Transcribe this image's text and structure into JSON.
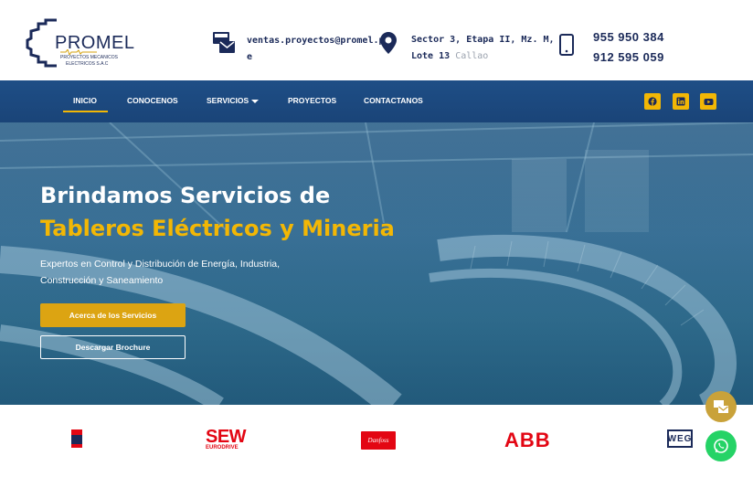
{
  "header": {
    "logo": {
      "name": "PROMEL",
      "subtitle_line1": "PROYECTOS MECANICOS",
      "subtitle_line2": "ELECTRICOS S.A.C"
    },
    "email": {
      "line1": "ventas.proyectos@promel.p",
      "line2": "e",
      "icon": "email-icon"
    },
    "address": {
      "line1": "Sector 3, Etapa II, Mz. M,",
      "line2_bold": "Lote 13",
      "line2_muted": "Callao",
      "icon": "map-pin-icon"
    },
    "phone": {
      "line1": "955 950 384",
      "line2": "912 595 059",
      "icon": "mobile-phone-icon"
    }
  },
  "nav": {
    "items": [
      {
        "label": "INICIO",
        "active": true
      },
      {
        "label": "CONOCENOS"
      },
      {
        "label": "SERVICIOS",
        "has_dropdown": true
      },
      {
        "label": "PROYECTOS"
      },
      {
        "label": "CONTACTANOS"
      }
    ],
    "social": [
      "facebook-icon",
      "linkedin-icon",
      "youtube-icon"
    ]
  },
  "hero": {
    "title_line1": "Brindamos Servicios de",
    "title_line2": "Tableros Eléctricos y Mineria",
    "subtitle_line1": "Expertos en Control y Distribución de Energía, Industria,",
    "subtitle_line2": "Construcción y Saneamiento",
    "primary_button": "Acerca de los Servicios",
    "secondary_button": "Descargar Brochure"
  },
  "brands": {
    "items": [
      {
        "name": "RITTAL",
        "icon": "rittal-logo"
      },
      {
        "name": "SEW",
        "sub": "EURODRIVE"
      },
      {
        "name": "Danfoss"
      },
      {
        "name": "ABB"
      },
      {
        "name": "WEG"
      }
    ]
  },
  "floating": {
    "chat": "chat-icon",
    "whatsapp": "whatsapp-icon"
  },
  "colors": {
    "navy": "#1b2a59",
    "nav_bg": "#1e4e86",
    "accent": "#f2b705",
    "whatsapp": "#25d366"
  }
}
